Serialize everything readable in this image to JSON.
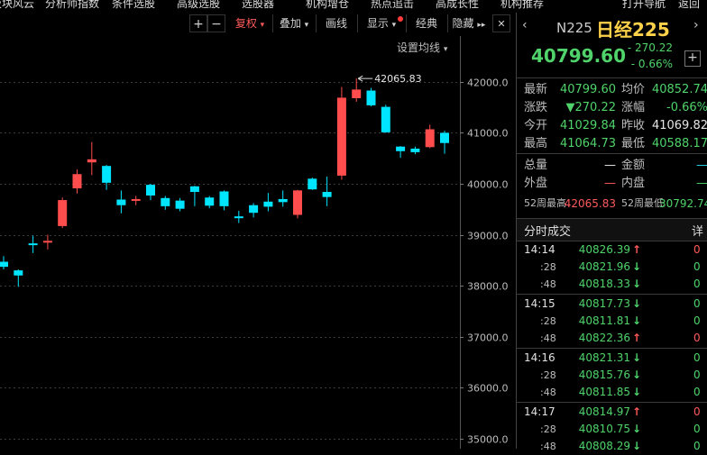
{
  "topmenu": [
    "板块风云",
    "分析师指数",
    "条件选股",
    "高级选股",
    "选股器",
    "机构增仓",
    "热点追击",
    "高成长性",
    "机构推荐",
    "打开导航",
    "返回"
  ],
  "toolbar": {
    "fuquan": "复权",
    "diejia": "叠加",
    "huaxian": "画线",
    "xianshi": "显示",
    "jingdian": "经典",
    "yincang": "隐藏"
  },
  "chart": {
    "ma_setting": "设置均线",
    "colors": {
      "up": "#ff4d4d",
      "down": "#00e5ff",
      "grid": "#3c3c3c",
      "axis_text": "#bdbdbd"
    }
  },
  "chart_data": {
    "type": "candlestick",
    "y_ticks": [
      "42000.0",
      "41000.0",
      "40000.0",
      "39000.0",
      "38000.0",
      "37000.0",
      "36000.0",
      "35000.0"
    ],
    "ylim": [
      34800,
      42900
    ],
    "annotation": "42065.83",
    "candles": [
      {
        "o": 38470,
        "c": 38370,
        "h": 38580,
        "l": 38320
      },
      {
        "o": 38300,
        "c": 38200,
        "h": 38320,
        "l": 37980
      },
      {
        "o": 38830,
        "c": 38810,
        "h": 38980,
        "l": 38640
      },
      {
        "o": 38860,
        "c": 38880,
        "h": 39000,
        "l": 38710
      },
      {
        "o": 39170,
        "c": 39680,
        "h": 39730,
        "l": 39130
      },
      {
        "o": 39910,
        "c": 40190,
        "h": 40280,
        "l": 39810
      },
      {
        "o": 40420,
        "c": 40480,
        "h": 40820,
        "l": 40170
      },
      {
        "o": 40350,
        "c": 40020,
        "h": 40370,
        "l": 39880
      },
      {
        "o": 39690,
        "c": 39580,
        "h": 39870,
        "l": 39420
      },
      {
        "o": 39680,
        "c": 39700,
        "h": 39760,
        "l": 39580
      },
      {
        "o": 39980,
        "c": 39770,
        "h": 40000,
        "l": 39680
      },
      {
        "o": 39720,
        "c": 39560,
        "h": 39760,
        "l": 39490
      },
      {
        "o": 39670,
        "c": 39510,
        "h": 39720,
        "l": 39460
      },
      {
        "o": 39950,
        "c": 39840,
        "h": 39960,
        "l": 39560
      },
      {
        "o": 39730,
        "c": 39570,
        "h": 39760,
        "l": 39520
      },
      {
        "o": 39850,
        "c": 39560,
        "h": 39870,
        "l": 39480
      },
      {
        "o": 39360,
        "c": 39340,
        "h": 39470,
        "l": 39230
      },
      {
        "o": 39580,
        "c": 39430,
        "h": 39620,
        "l": 39340
      },
      {
        "o": 39650,
        "c": 39550,
        "h": 39820,
        "l": 39460
      },
      {
        "o": 39700,
        "c": 39640,
        "h": 39870,
        "l": 39550
      },
      {
        "o": 39390,
        "c": 39870,
        "h": 39880,
        "l": 39320
      },
      {
        "o": 40100,
        "c": 39890,
        "h": 40120,
        "l": 39880
      },
      {
        "o": 39840,
        "c": 39740,
        "h": 40140,
        "l": 39560
      },
      {
        "o": 40160,
        "c": 41690,
        "h": 41900,
        "l": 40080
      },
      {
        "o": 41680,
        "c": 41850,
        "h": 42066,
        "l": 41610
      },
      {
        "o": 41830,
        "c": 41540,
        "h": 41880,
        "l": 41520
      },
      {
        "o": 41510,
        "c": 41010,
        "h": 41550,
        "l": 41000
      },
      {
        "o": 40730,
        "c": 40640,
        "h": 40740,
        "l": 40510
      },
      {
        "o": 40690,
        "c": 40620,
        "h": 40730,
        "l": 40580
      },
      {
        "o": 40720,
        "c": 41070,
        "h": 41160,
        "l": 40700
      },
      {
        "o": 41000,
        "c": 40800,
        "h": 41040,
        "l": 40590
      }
    ]
  },
  "quote": {
    "code": "N225",
    "name": "日经225",
    "price": "40799.60",
    "change": "- 270.22",
    "change_pct": "- 0.66%",
    "plus": "+",
    "rows": [
      {
        "l1": "最新",
        "v1": "40799.60",
        "c1": "green",
        "l2": "均价",
        "v2": "40852.74",
        "c2": "green"
      },
      {
        "l1": "涨跌",
        "v1": "▼270.22",
        "c1": "green",
        "l2": "涨幅",
        "v2": "-0.66%",
        "c2": "green"
      },
      {
        "l1": "今开",
        "v1": "41029.84",
        "c1": "green",
        "l2": "昨收",
        "v2": "41069.82",
        "c2": "white"
      },
      {
        "l1": "最高",
        "v1": "41064.73",
        "c1": "green",
        "l2": "最低",
        "v2": "40588.17",
        "c2": "green"
      },
      {
        "l1": "总量",
        "v1": "—",
        "c1": "white",
        "l2": "金额",
        "v2": "—",
        "c2": "cyan"
      },
      {
        "l1": "外盘",
        "v1": "—",
        "c1": "red",
        "l2": "内盘",
        "v2": "—",
        "c2": "green"
      }
    ],
    "w52": {
      "l1": "52周最高",
      "v1": "42065.83",
      "l2": "52周最低",
      "v2": "30792.74"
    }
  },
  "ticks": {
    "title": "分时成交",
    "detail": "详",
    "rows": [
      {
        "t": "14:14",
        "p": "40826.39",
        "d": "↑",
        "dc": "red",
        "v": "0"
      },
      {
        "t": ":28",
        "p": "40821.96",
        "d": "↓",
        "dc": "green",
        "v": "0"
      },
      {
        "t": ":48",
        "p": "40818.33",
        "d": "↓",
        "dc": "green",
        "v": "0"
      },
      {
        "t": "14:15",
        "p": "40817.73",
        "d": "↓",
        "dc": "green",
        "v": "0"
      },
      {
        "t": ":28",
        "p": "40811.81",
        "d": "↓",
        "dc": "green",
        "v": "0"
      },
      {
        "t": ":48",
        "p": "40822.36",
        "d": "↑",
        "dc": "red",
        "v": "0"
      },
      {
        "t": "14:16",
        "p": "40821.31",
        "d": "↓",
        "dc": "green",
        "v": "0"
      },
      {
        "t": ":28",
        "p": "40815.76",
        "d": "↓",
        "dc": "green",
        "v": "0"
      },
      {
        "t": ":48",
        "p": "40811.85",
        "d": "↓",
        "dc": "green",
        "v": "0"
      },
      {
        "t": "14:17",
        "p": "40814.97",
        "d": "↑",
        "dc": "red",
        "v": "0"
      },
      {
        "t": ":28",
        "p": "40810.75",
        "d": "↓",
        "dc": "green",
        "v": "0"
      },
      {
        "t": ":48",
        "p": "40808.29",
        "d": "↓",
        "dc": "green",
        "v": "0"
      }
    ]
  }
}
